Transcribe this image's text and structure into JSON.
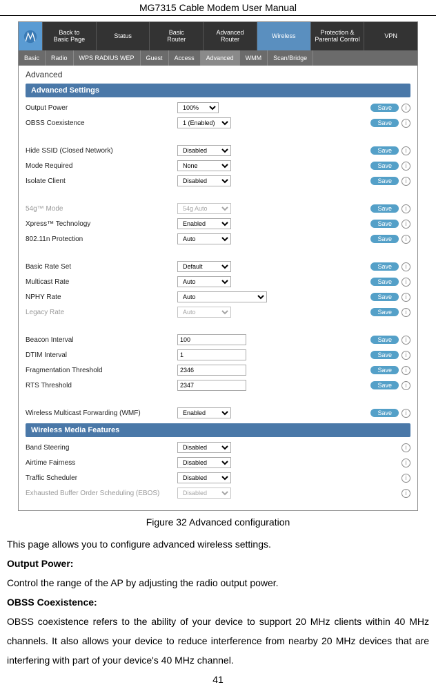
{
  "header": {
    "title": "MG7315 Cable Modem User Manual"
  },
  "ui": {
    "topnav": [
      {
        "label": "Back to\nBasic Page"
      },
      {
        "label": "Status"
      },
      {
        "label": "Basic\nRouter"
      },
      {
        "label": "Advanced\nRouter"
      },
      {
        "label": "Wireless",
        "active": true
      },
      {
        "label": "Protection &\nParental Control"
      },
      {
        "label": "VPN"
      }
    ],
    "subnav": [
      {
        "label": "Basic"
      },
      {
        "label": "Radio"
      },
      {
        "label": "WPS RADIUS WEP"
      },
      {
        "label": "Guest"
      },
      {
        "label": "Access"
      },
      {
        "label": "Advanced",
        "active": true
      },
      {
        "label": "WMM"
      },
      {
        "label": "Scan/Bridge"
      }
    ],
    "pageSub": "Advanced",
    "section1": "Advanced Settings",
    "section2": "Wireless Media Features",
    "saveLabel": "Save",
    "group1": [
      {
        "label": "Output Power",
        "type": "select",
        "value": "100%",
        "cls": "narrow"
      },
      {
        "label": "OBSS Coexistence",
        "type": "select",
        "value": "1 (Enabled)",
        "cls": "med"
      }
    ],
    "group2": [
      {
        "label": "Hide SSID (Closed Network)",
        "type": "select",
        "value": "Disabled",
        "cls": "med"
      },
      {
        "label": "Mode Required",
        "type": "select",
        "value": "None",
        "cls": "med"
      },
      {
        "label": "Isolate Client",
        "type": "select",
        "value": "Disabled",
        "cls": "med"
      }
    ],
    "group3": [
      {
        "label": "54g™ Mode",
        "type": "select",
        "value": "54g Auto",
        "cls": "med",
        "dim": true
      },
      {
        "label": "Xpress™ Technology",
        "type": "select",
        "value": "Enabled",
        "cls": "med"
      },
      {
        "label": "802.11n Protection",
        "type": "select",
        "value": "Auto",
        "cls": "med"
      }
    ],
    "group4": [
      {
        "label": "Basic Rate Set",
        "type": "select",
        "value": "Default",
        "cls": "med"
      },
      {
        "label": "Multicast Rate",
        "type": "select",
        "value": "Auto",
        "cls": "med"
      },
      {
        "label": "NPHY Rate",
        "type": "select",
        "value": "Auto",
        "cls": "wide"
      },
      {
        "label": "Legacy Rate",
        "type": "select",
        "value": "Auto",
        "cls": "med",
        "dim": true
      }
    ],
    "group5": [
      {
        "label": "Beacon Interval",
        "type": "text",
        "value": "100"
      },
      {
        "label": "DTIM Interval",
        "type": "text",
        "value": "1"
      },
      {
        "label": "Fragmentation Threshold",
        "type": "text",
        "value": "2346"
      },
      {
        "label": "RTS Threshold",
        "type": "text",
        "value": "2347"
      }
    ],
    "group6": [
      {
        "label": "Wireless Multicast Forwarding (WMF)",
        "type": "select",
        "value": "Enabled",
        "cls": "med"
      }
    ],
    "group7": [
      {
        "label": "Band Steering",
        "type": "select",
        "value": "Disabled",
        "cls": "med",
        "noSave": true
      },
      {
        "label": "Airtime Fairness",
        "type": "select",
        "value": "Disabled",
        "cls": "med",
        "noSave": true
      },
      {
        "label": "Traffic Scheduler",
        "type": "select",
        "value": "Disabled",
        "cls": "med",
        "noSave": true
      },
      {
        "label": "Exhausted Buffer Order Scheduling (EBOS)",
        "type": "select",
        "value": "Disabled",
        "cls": "med",
        "noSave": true,
        "dim": true
      }
    ]
  },
  "caption": "Figure 32 Advanced configuration",
  "para1": "This page allows you to configure advanced wireless settings.",
  "h1": "Output Power:",
  "para2": "Control the range of the AP by adjusting the radio output power.",
  "h2": "OBSS Coexistence:",
  "para3": "OBSS coexistence refers to the ability of your device to support 20 MHz clients within 40 MHz channels. It also allows your device to reduce interference from nearby 20 MHz devices that are interfering with part of your device's 40 MHz channel.",
  "pageNum": "41"
}
